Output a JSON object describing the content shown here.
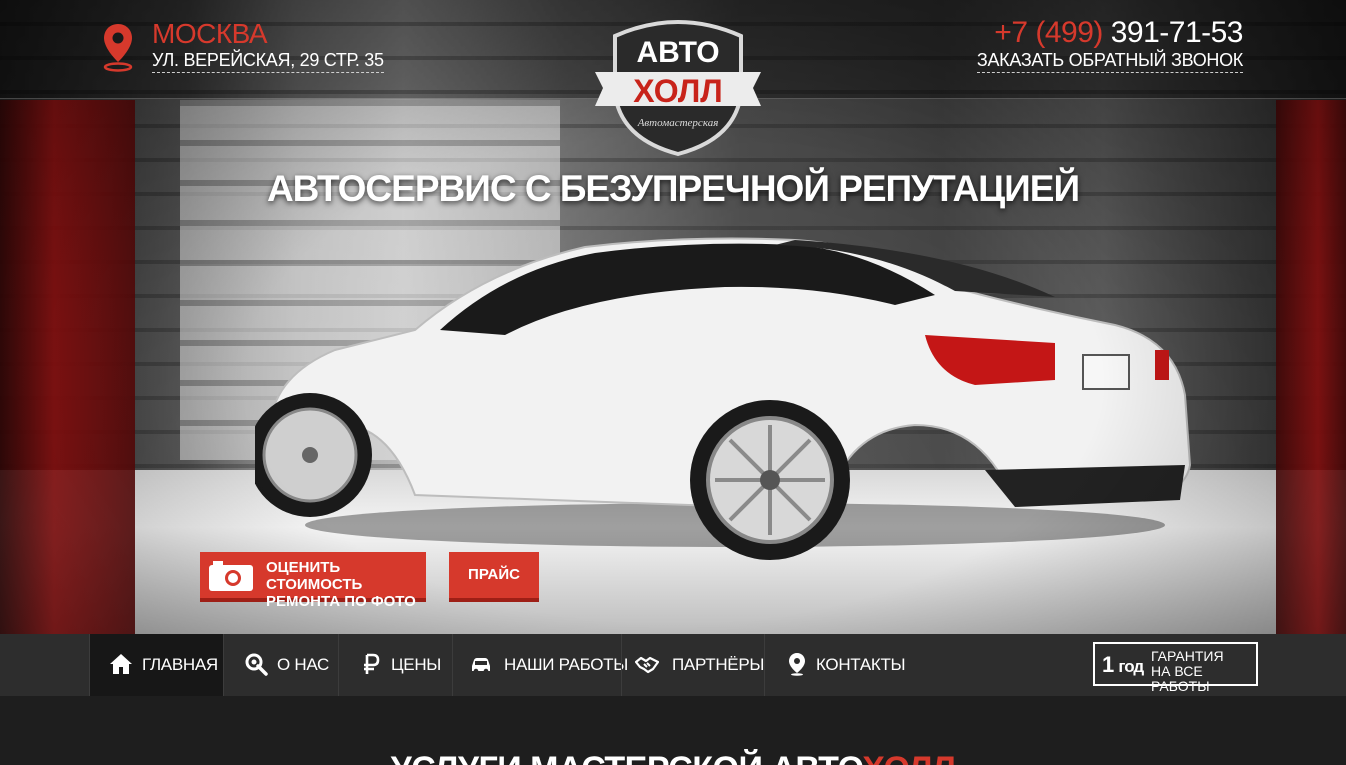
{
  "header": {
    "city": "МОСКВА",
    "address": "УЛ. ВЕРЕЙСКАЯ, 29 СТР. 35",
    "phone_code": "+7 (499)",
    "phone_number": "391-71-53",
    "callback_link": "ЗАКАЗАТЬ ОБРАТНЫЙ ЗВОНОК"
  },
  "logo": {
    "line1": "АВТО",
    "line2": "ХОЛЛ",
    "subtitle": "Автомастерская"
  },
  "hero": {
    "tagline": "АВТОСЕРВИС С БЕЗУПРЕЧНОЙ РЕПУТАЦИЕЙ",
    "estimate_button_line1": "ОЦЕНИТЬ СТОИМОСТЬ",
    "estimate_button_line2": "РЕМОНТА ПО ФОТО",
    "price_button": "ПРАЙС"
  },
  "nav": {
    "items": [
      {
        "label": "ГЛАВНАЯ",
        "icon": "home-icon",
        "active": true
      },
      {
        "label": "О НАС",
        "icon": "wrench-gear-icon"
      },
      {
        "label": "ЦЕНЫ",
        "icon": "ruble-icon"
      },
      {
        "label": "НАШИ РАБОТЫ",
        "icon": "car-icon"
      },
      {
        "label": "ПАРТНЁРЫ",
        "icon": "handshake-icon"
      },
      {
        "label": "КОНТАКТЫ",
        "icon": "location-pin-icon"
      }
    ]
  },
  "warranty": {
    "number": "1",
    "unit": "год",
    "line1": "ГАРАНТИЯ",
    "line2": "НА ВСЕ РАБОТЫ"
  },
  "section": {
    "title_main": "УСЛУГИ МАСТЕРСКОЙ АВТО",
    "title_accent": "ХОЛЛ"
  },
  "colors": {
    "accent": "#d6392c",
    "nav_bg": "#2d2d2d",
    "nav_active_bg": "#171717"
  }
}
